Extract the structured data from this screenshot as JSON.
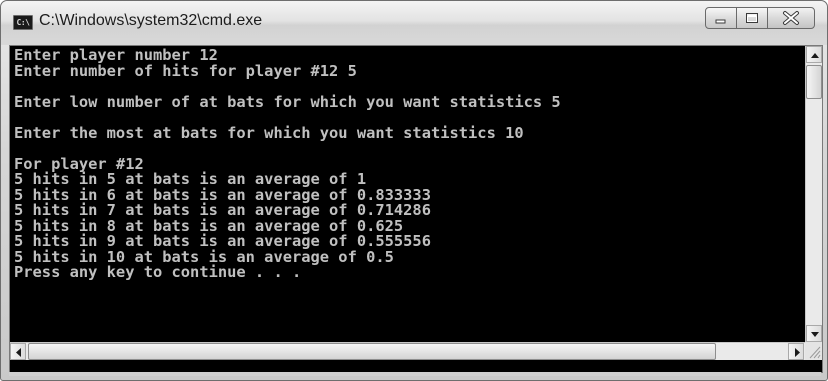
{
  "window": {
    "title": "C:\\Windows\\system32\\cmd.exe",
    "icon": "console-icon",
    "icon_text": "C:\\"
  },
  "caption_buttons": {
    "minimize": "minimize-icon",
    "maximize": "maximize-icon",
    "close": "close-icon"
  },
  "console": {
    "lines": [
      "Enter player number 12",
      "Enter number of hits for player #12 5",
      "",
      "Enter low number of at bats for which you want statistics 5",
      "",
      "Enter the most at bats for which you want statistics 10",
      "",
      "For player #12",
      "5 hits in 5 at bats is an average of 1",
      "5 hits in 6 at bats is an average of 0.833333",
      "5 hits in 7 at bats is an average of 0.714286",
      "5 hits in 8 at bats is an average of 0.625",
      "5 hits in 9 at bats is an average of 0.555556",
      "5 hits in 10 at bats is an average of 0.5",
      "Press any key to continue . . ."
    ],
    "text_color": "#c0c0c0",
    "background": "#000000"
  },
  "scrollbars": {
    "vertical": {
      "up": "arrow-up-icon",
      "down": "arrow-down-icon"
    },
    "horizontal": {
      "left": "arrow-left-icon",
      "right": "arrow-right-icon"
    }
  }
}
